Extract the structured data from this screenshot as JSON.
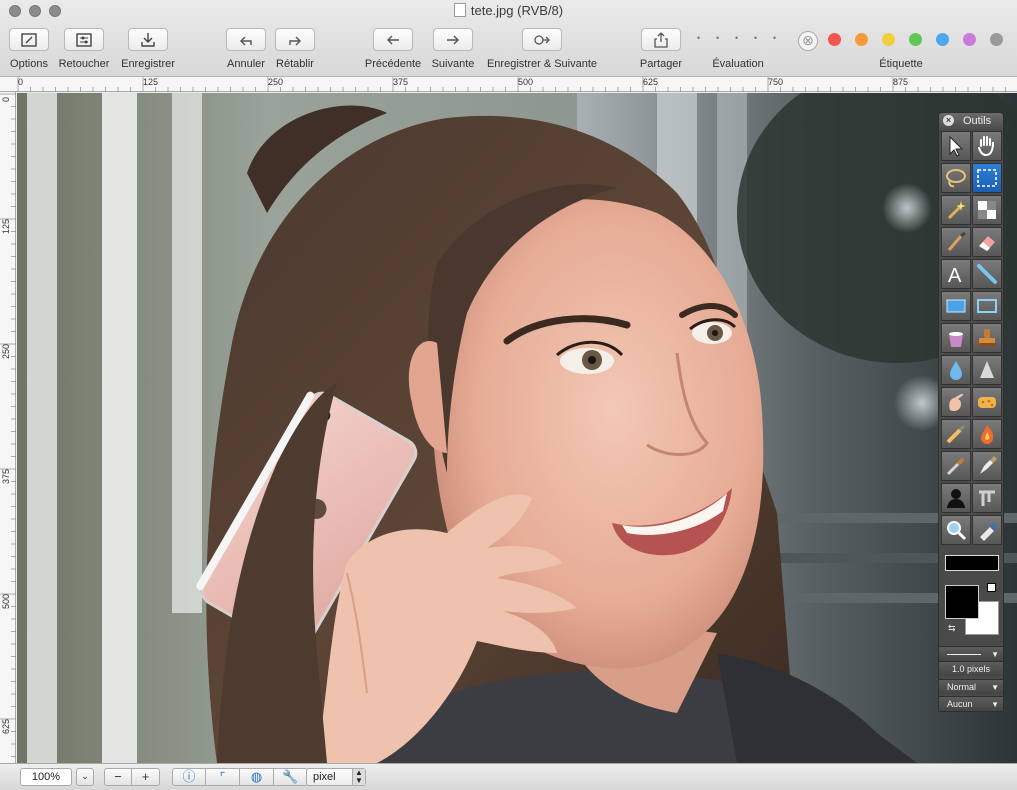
{
  "window": {
    "title": "tete.jpg (RVB/8)"
  },
  "toolbar": {
    "options": "Options",
    "retoucher": "Retoucher",
    "enregistrer": "Enregistrer",
    "annuler": "Annuler",
    "retablir": "Rétablir",
    "precedente": "Précédente",
    "suivante": "Suivante",
    "enregistrer_suivante": "Enregistrer & Suivante",
    "partager": "Partager",
    "evaluation": "Évaluation",
    "etiquette": "Étiquette"
  },
  "label_colors": [
    "#f2564e",
    "#f49a3a",
    "#f1cf3a",
    "#60c656",
    "#4fa8ea",
    "#c97bdc",
    "#9a9a9a"
  ],
  "ruler": {
    "h_ticks": [
      "0",
      "125",
      "250",
      "375",
      "500",
      "625",
      "750",
      "875"
    ],
    "v_ticks": [
      "0",
      "125",
      "250",
      "375",
      "500",
      "625"
    ]
  },
  "palette": {
    "title": "Outils",
    "stroke_width": "1.0 pixels",
    "blend_mode": "Normal",
    "fill_mode": "Aucun"
  },
  "status": {
    "zoom": "100%",
    "unit": "pixel"
  }
}
